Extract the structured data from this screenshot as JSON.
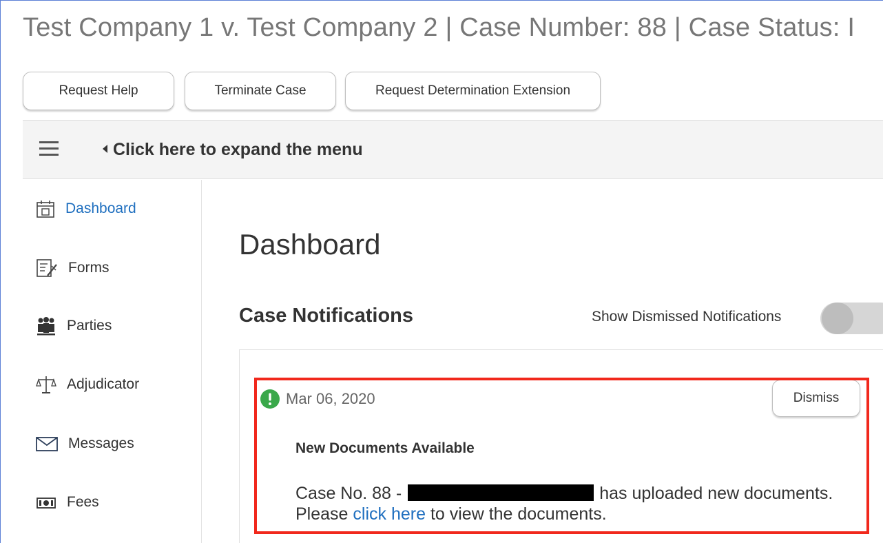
{
  "header": {
    "case_title": "Test Company 1 v. Test Company 2 | Case Number: 88 | Case Status:  I"
  },
  "actions": {
    "request_help": "Request Help",
    "terminate_case": "Terminate Case",
    "request_extension": "Request Determination Extension"
  },
  "menu": {
    "expand_label": "Click here to expand the menu"
  },
  "sidebar": {
    "items": [
      {
        "label": "Dashboard",
        "icon": "calendar-icon",
        "active": true
      },
      {
        "label": "Forms",
        "icon": "forms-icon"
      },
      {
        "label": "Parties",
        "icon": "parties-icon"
      },
      {
        "label": "Adjudicator",
        "icon": "scales-icon"
      },
      {
        "label": "Messages",
        "icon": "envelope-icon"
      },
      {
        "label": "Fees",
        "icon": "money-icon"
      }
    ]
  },
  "main": {
    "page_title": "Dashboard",
    "section_title": "Case Notifications",
    "toggle_label": "Show Dismissed Notifications",
    "notification": {
      "date": "Mar 06, 2020",
      "dismiss_label": "Dismiss",
      "title": "New Documents Available",
      "body_prefix": "Case No. 88 -",
      "body_middle": "has uploaded new documents. Please",
      "link_text": "click here",
      "body_suffix": "to view the documents."
    }
  },
  "colors": {
    "accent_link": "#1f6fbf",
    "highlight_border": "#f1281c",
    "alert_icon": "#3aa84a"
  }
}
